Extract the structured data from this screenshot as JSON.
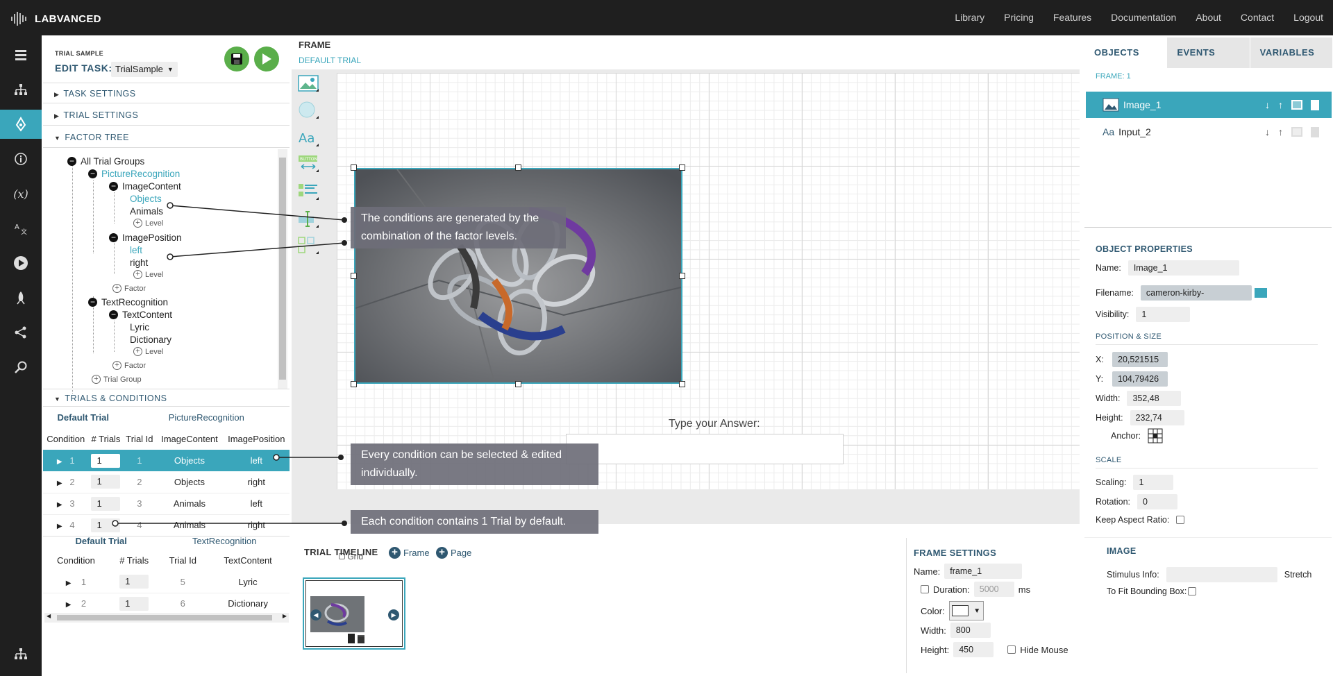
{
  "brand": "LABVANCED",
  "nav": [
    "Library",
    "Pricing",
    "Features",
    "Documentation",
    "About",
    "Contact",
    "Logout"
  ],
  "left": {
    "trial_sample": "TRIAL SAMPLE",
    "edit_task_label": "EDIT TASK:",
    "edit_task_value": "TrialSample",
    "sections": {
      "task_settings": "TASK SETTINGS",
      "trial_settings": "TRIAL SETTINGS",
      "factor_tree": "FACTOR TREE",
      "trials_conditions": "TRIALS & CONDITIONS"
    },
    "tree": {
      "all": "All Trial Groups",
      "g1": "PictureRecognition",
      "f1": "ImageContent",
      "f1l1": "Objects",
      "f1l2": "Animals",
      "f2": "ImagePosition",
      "f2l1": "left",
      "f2l2": "right",
      "g2": "TextRecognition",
      "f3": "TextContent",
      "f3l1": "Lyric",
      "f3l2": "Dictionary",
      "level": "Level",
      "factor": "Factor",
      "trial_group": "Trial Group"
    },
    "table1": {
      "default_trial": "Default Trial",
      "group": "PictureRecognition",
      "headers": [
        "Condition",
        "# Trials",
        "Trial Id",
        "ImageContent",
        "ImagePosition"
      ],
      "rows": [
        {
          "cond": "1",
          "trials": "1",
          "id": "1",
          "c1": "Objects",
          "c2": "left"
        },
        {
          "cond": "2",
          "trials": "1",
          "id": "2",
          "c1": "Objects",
          "c2": "right"
        },
        {
          "cond": "3",
          "trials": "1",
          "id": "3",
          "c1": "Animals",
          "c2": "left"
        },
        {
          "cond": "4",
          "trials": "1",
          "id": "4",
          "c1": "Animals",
          "c2": "right"
        }
      ]
    },
    "table2": {
      "default_trial": "Default Trial",
      "group": "TextRecognition",
      "headers": [
        "Condition",
        "# Trials",
        "Trial Id",
        "TextContent"
      ],
      "rows": [
        {
          "cond": "1",
          "trials": "1",
          "id": "5",
          "c1": "Lyric"
        },
        {
          "cond": "2",
          "trials": "1",
          "id": "6",
          "c1": "Dictionary"
        }
      ]
    }
  },
  "center": {
    "frame": "FRAME",
    "default_trial": "DEFAULT TRIAL",
    "answer_label": "Type your Answer:",
    "grid": "Grid",
    "tooltips": {
      "t1": "The conditions are generated by the combination of the factor levels.",
      "t2": "Every condition can be selected & edited individually.",
      "t3": "Each condition contains 1 Trial by default."
    },
    "timeline": {
      "title": "TRIAL TIMELINE",
      "frame_btn": "Frame",
      "page_btn": "Page"
    },
    "frame_settings": {
      "title": "FRAME SETTINGS",
      "name_label": "Name:",
      "name_value": "frame_1",
      "duration_label": "Duration:",
      "duration_value": "5000",
      "duration_unit": "ms",
      "color_label": "Color:",
      "width_label": "Width:",
      "width_value": "800",
      "height_label": "Height:",
      "height_value": "450",
      "hide_mouse": "Hide Mouse"
    }
  },
  "right": {
    "tabs": [
      "OBJECTS",
      "EVENTS",
      "VARIABLES"
    ],
    "frame_label": "FRAME: 1",
    "objects": [
      "Image_1",
      "Input_2"
    ],
    "props": {
      "title": "OBJECT PROPERTIES",
      "name_label": "Name:",
      "name_value": "Image_1",
      "filename_label": "Filename:",
      "filename_value": "cameron-kirby-",
      "visibility_label": "Visibility:",
      "visibility_value": "1",
      "pos_title": "POSITION & SIZE",
      "x_label": "X:",
      "x_value": "20,521515",
      "y_label": "Y:",
      "y_value": "104,79426",
      "width_label": "Width:",
      "width_value": "352,48",
      "height_label": "Height:",
      "height_value": "232,74",
      "anchor_label": "Anchor:",
      "scale_title": "SCALE",
      "scaling_label": "Scaling:",
      "scaling_value": "1",
      "rotation_label": "Rotation:",
      "rotation_value": "0",
      "keep_aspect_label": "Keep Aspect Ratio:",
      "image_title": "IMAGE",
      "stimulus_label": "Stimulus Info:",
      "stretch_label": "Stretch",
      "fit_label": "To Fit Bounding Box:"
    }
  },
  "colors": {
    "accent": "#3aa6bb",
    "dark": "#1f1f1f",
    "navy": "#2f5871"
  }
}
